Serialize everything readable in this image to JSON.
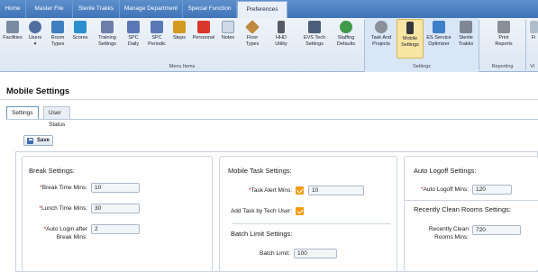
{
  "menu": {
    "tabs": [
      {
        "label": "Home"
      },
      {
        "label": "Master File"
      },
      {
        "label": "Sterile Trakks"
      },
      {
        "label": "Manage Department"
      },
      {
        "label": "Special Function"
      },
      {
        "label": "Preferences"
      }
    ],
    "active": "Preferences"
  },
  "ribbon": {
    "items": [
      {
        "label": "Facilities",
        "icon": "facilities-icon",
        "color": "#7a8aa0"
      },
      {
        "label": "Users",
        "sub": "▾",
        "icon": "users-icon",
        "color": "#4f6fa3"
      },
      {
        "label": "Room Types",
        "icon": "room-types-icon",
        "color": "#3f7fbf"
      },
      {
        "label": "Scores",
        "icon": "scores-icon",
        "color": "#2c8fcf"
      },
      {
        "label": "Training Settings",
        "icon": "training-icon",
        "color": "#6c7fa8"
      },
      {
        "label": "SPC Daily",
        "icon": "spc-daily-icon",
        "color": "#5a78b8"
      },
      {
        "label": "SPC Periodic",
        "icon": "spc-periodic-icon",
        "color": "#5a78b8"
      },
      {
        "label": "Steps",
        "icon": "steps-icon",
        "color": "#d49a1e"
      },
      {
        "label": "Personnel",
        "icon": "personnel-icon",
        "color": "#d9372b"
      },
      {
        "label": "Notes",
        "icon": "notes-icon",
        "color": "#cfd8e6"
      },
      {
        "label": "Floor Types",
        "icon": "floor-types-icon",
        "color": "#c08a3e"
      },
      {
        "label": "HHD Utility",
        "icon": "hhd-utility-icon",
        "color": "#555b66"
      },
      {
        "label": "EVS Tech Settings",
        "icon": "evs-tech-icon",
        "color": "#4a5f7a"
      },
      {
        "label": "Staffing Defaults",
        "icon": "staffing-icon",
        "color": "#3f9a4a"
      },
      {
        "label": "Task And Projects",
        "icon": "gear-icon",
        "color": "#8a8f99"
      },
      {
        "label": "Mobile Settings",
        "icon": "mobile-icon",
        "color": "#33363c"
      },
      {
        "label": "ES Service Optimizer",
        "icon": "optimizer-icon",
        "color": "#3d7fc8"
      },
      {
        "label": "Sterile Trakks",
        "icon": "sterile-trakks-icon",
        "color": "#7d8796"
      },
      {
        "label": "Print Reports",
        "icon": "printer-icon",
        "color": "#8a8f99"
      },
      {
        "label": "Fi",
        "icon": "partial-icon",
        "color": "#b1bccb"
      }
    ],
    "groups": [
      {
        "label": "Menu Items"
      },
      {
        "label": "Settings"
      },
      {
        "label": "Reporting"
      },
      {
        "label": "Vi"
      }
    ]
  },
  "page": {
    "title": "Mobile Settings",
    "tabs": [
      {
        "label": "Settings"
      },
      {
        "label": "User Status"
      }
    ],
    "save_label": "Save"
  },
  "break": {
    "title": "Break Settings:",
    "break_time_label": "Break Time Mins:",
    "break_time_value": "10",
    "lunch_time_label": "Lunch Time Mins:",
    "lunch_time_value": "30",
    "auto_login_label_1": "Auto Login after",
    "auto_login_label_2": "Break Mins:",
    "auto_login_value": "2"
  },
  "mobile_task": {
    "title": "Mobile Task Settings:",
    "alert_label": "Task Alert Mins:",
    "alert_value": "10",
    "add_task_label": "Add Task by Tech User:",
    "batch_title": "Batch Limit Settings:",
    "batch_label": "Batch Limit:",
    "batch_value": "100"
  },
  "auto_logoff": {
    "title": "Auto Logoff Settings:",
    "mins_label": "Auto Logoff Mins:",
    "mins_value": "120",
    "recent_title": "Recently Clean Rooms Settings:",
    "recent_label_1": "Recently Clean",
    "recent_label_2": "Rooms Mins:",
    "recent_value": "720"
  },
  "required_mark": "*"
}
